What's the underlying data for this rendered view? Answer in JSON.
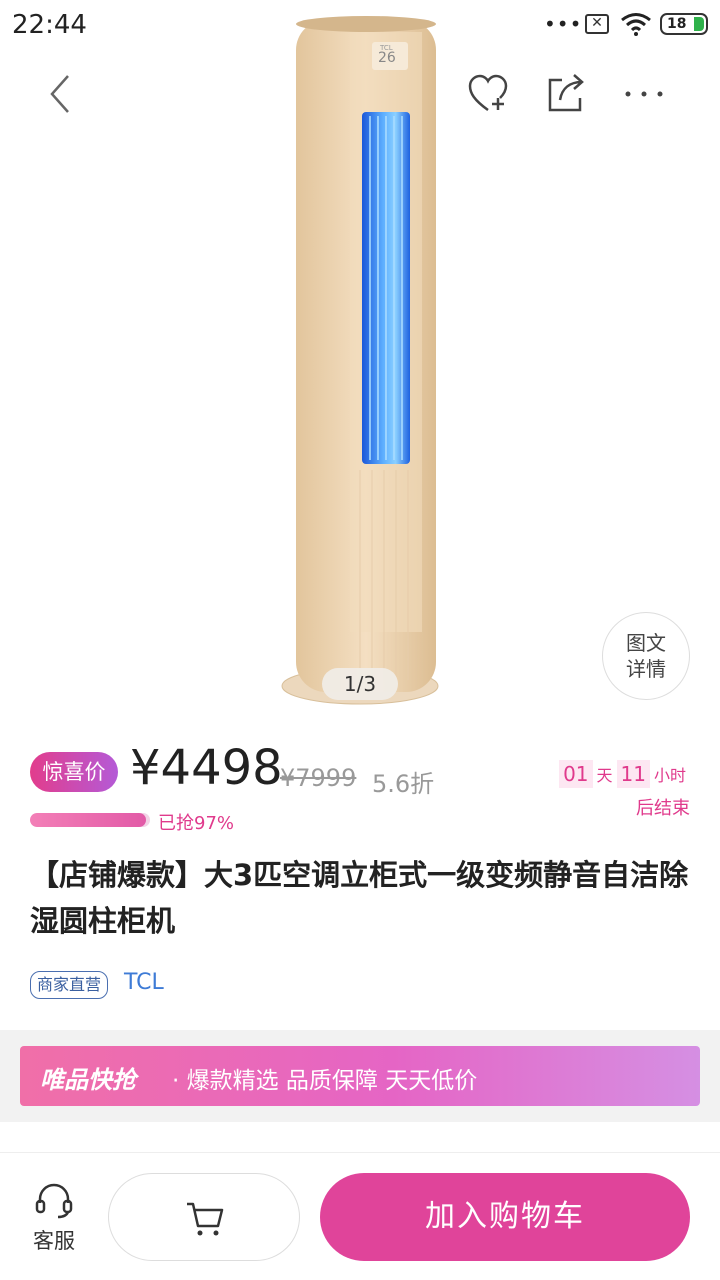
{
  "status_bar": {
    "time": "22:44",
    "dots": "•••",
    "battery": "18"
  },
  "product": {
    "pager": "1/3",
    "detail_label_line1": "图文",
    "detail_label_line2": "详情",
    "brand_logo": "TCL",
    "panel_display": "26"
  },
  "price": {
    "tag": "惊喜价",
    "current": "¥4498",
    "original": "¥7999",
    "discount": "5.6折",
    "sold_percent": 97,
    "sold_text": "已抢97%"
  },
  "countdown": {
    "days": "01",
    "day_unit": "天",
    "hours": "11",
    "hour_unit": "小时",
    "suffix": "后结束"
  },
  "title": "【店铺爆款】大3匹空调立柜式一级变频静音自洁除湿圆柱柜机",
  "badge": "商家直营",
  "brand": "TCL",
  "banner": {
    "logo": "唯品快抢",
    "text": "· 爆款精选  品质保障  天天低价"
  },
  "bottom_bar": {
    "service_label": "客服",
    "add_to_cart": "加入购物车"
  },
  "colors": {
    "accent": "#e0449a",
    "gold": "#e8cfae",
    "blue_grille": "#3b8ff0"
  }
}
